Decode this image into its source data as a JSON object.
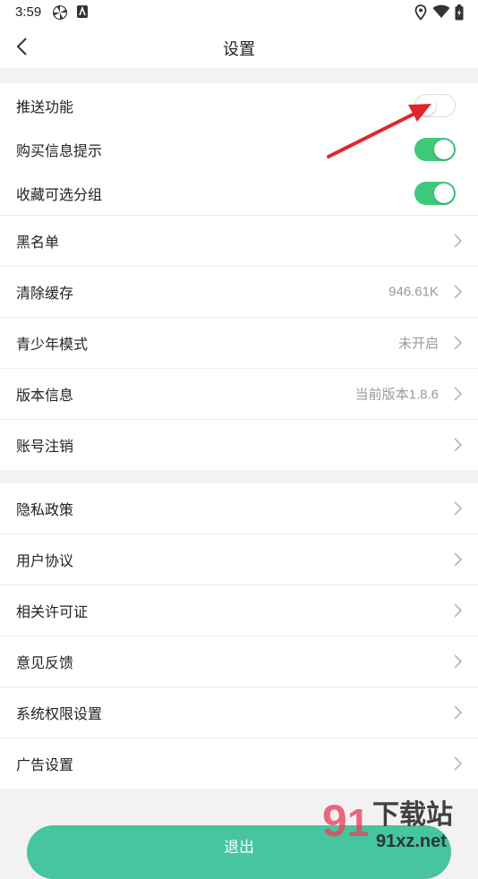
{
  "status_bar": {
    "time": "3:59"
  },
  "header": {
    "title": "设置"
  },
  "toggles": [
    {
      "label": "推送功能",
      "on": false
    },
    {
      "label": "购买信息提示",
      "on": true
    },
    {
      "label": "收藏可选分组",
      "on": true
    }
  ],
  "group1": [
    {
      "label": "黑名单",
      "value": ""
    },
    {
      "label": "清除缓存",
      "value": "946.61K"
    },
    {
      "label": "青少年模式",
      "value": "未开启"
    },
    {
      "label": "版本信息",
      "value": "当前版本1.8.6"
    },
    {
      "label": "账号注销",
      "value": ""
    }
  ],
  "group2": [
    {
      "label": "隐私政策"
    },
    {
      "label": "用户协议"
    },
    {
      "label": "相关许可证"
    },
    {
      "label": "意见反馈"
    },
    {
      "label": "系统权限设置"
    },
    {
      "label": "广告设置"
    }
  ],
  "logout_label": "退出",
  "watermark": {
    "brand": "下载站",
    "site": "91xz.net"
  },
  "colors": {
    "switch_on": "#3ec97a",
    "logout": "#47c4a0",
    "arrow": "#e0262a"
  }
}
